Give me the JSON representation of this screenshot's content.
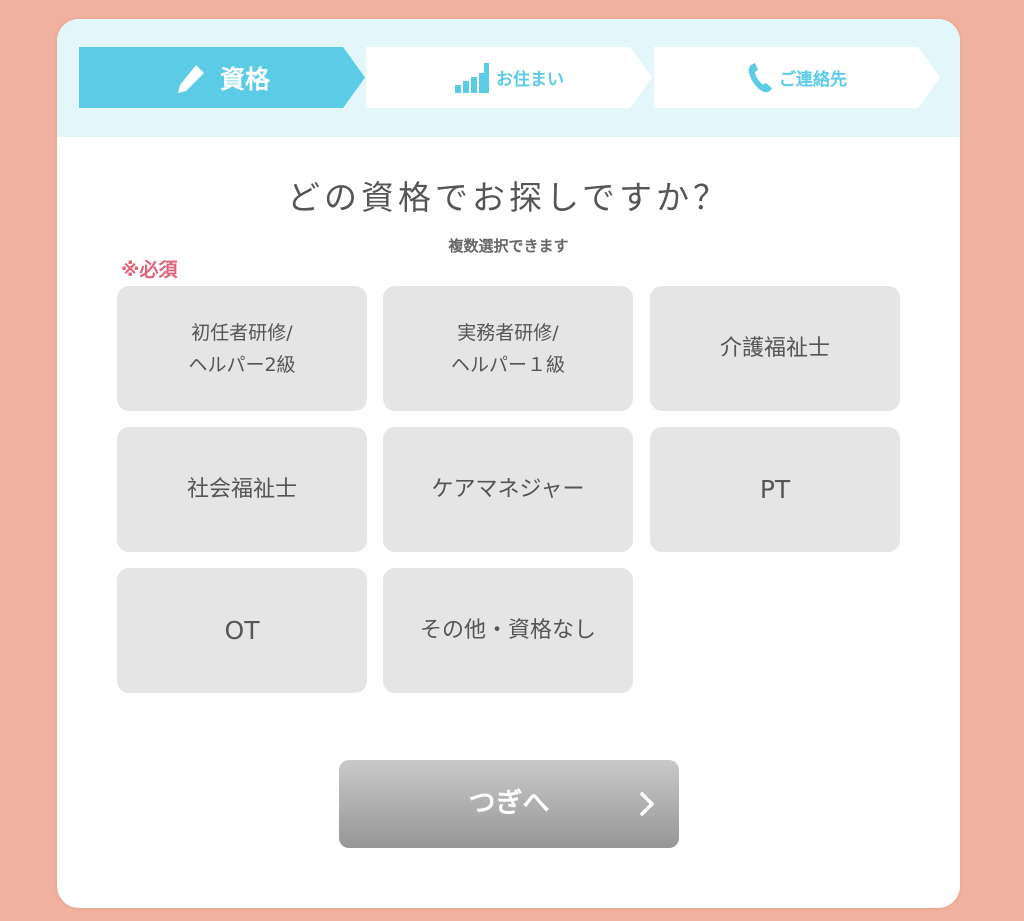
{
  "steps": [
    {
      "label": "資格",
      "icon": "pencil-icon",
      "active": true
    },
    {
      "label": "お住まい",
      "icon": "signal-bars-icon",
      "active": false
    },
    {
      "label": "ご連絡先",
      "icon": "phone-icon",
      "active": false
    }
  ],
  "colors": {
    "accent": "#5ccbe5",
    "required": "#e0647a",
    "background": "#f0b19e",
    "option_bg": "#e5e5e5"
  },
  "main": {
    "title": "どの資格でお探しですか？",
    "subtitle": "複数選択できます",
    "required_label": "※必須"
  },
  "options": [
    {
      "lines": [
        "初任者研修/",
        "ヘルパー2級"
      ]
    },
    {
      "lines": [
        "実務者研修/",
        "ヘルパー１級"
      ]
    },
    {
      "lines": [
        "介護福祉士"
      ]
    },
    {
      "lines": [
        "社会福祉士"
      ]
    },
    {
      "lines": [
        "ケアマネジャー"
      ]
    },
    {
      "lines": [
        "PT"
      ]
    },
    {
      "lines": [
        "OT"
      ]
    },
    {
      "lines": [
        "その他・資格なし"
      ]
    }
  ],
  "next_button": {
    "label": "つぎへ",
    "icon": "chevron-right-icon"
  }
}
